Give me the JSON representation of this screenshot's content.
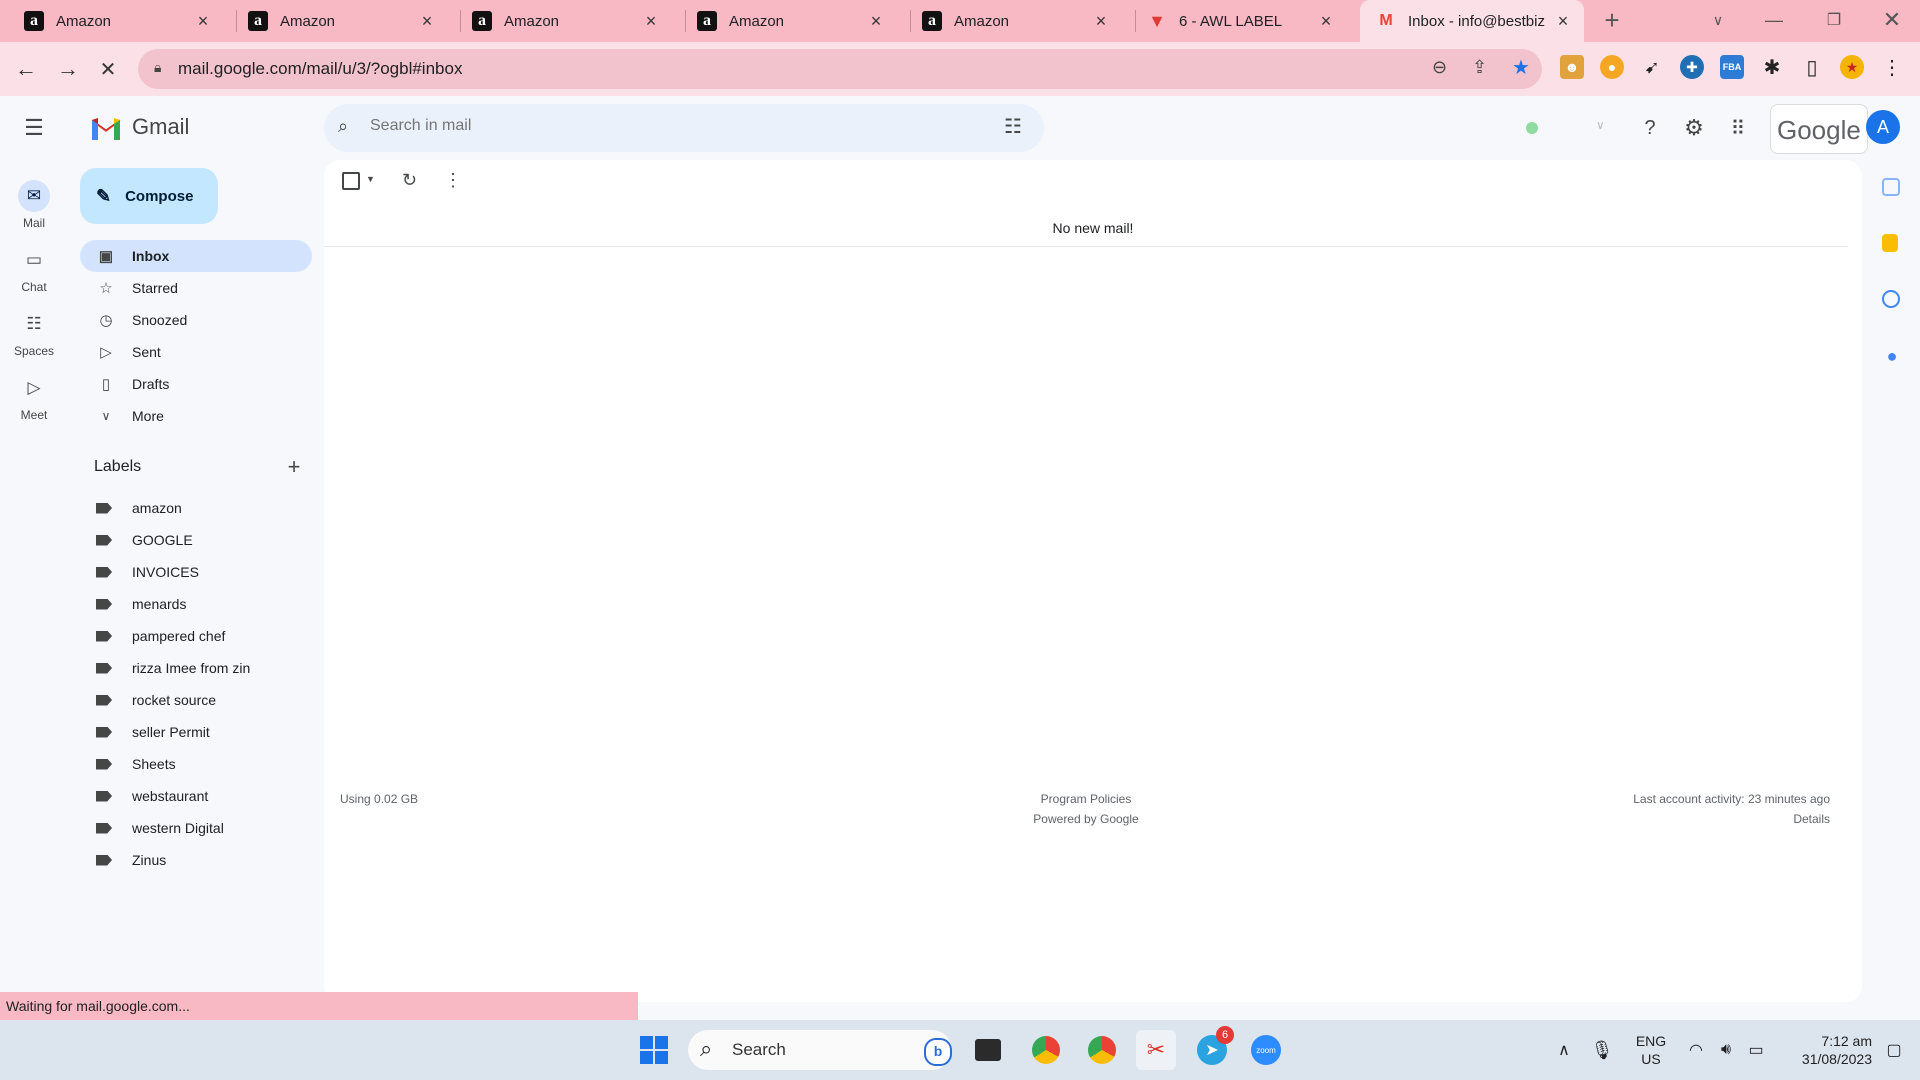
{
  "browser": {
    "tabs": [
      {
        "title": "Amazon",
        "favicon": "amazon-icon"
      },
      {
        "title": "Amazon",
        "favicon": "amazon-icon"
      },
      {
        "title": "Amazon",
        "favicon": "amazon-icon"
      },
      {
        "title": "Amazon",
        "favicon": "amazon-icon"
      },
      {
        "title": "Amazon",
        "favicon": "amazon-icon"
      },
      {
        "title": "6 - AWL LABEL",
        "favicon": "awl-icon"
      },
      {
        "title": "Inbox - info@bestbiz",
        "favicon": "gmail-icon",
        "active": true
      }
    ],
    "url": "mail.google.com/mail/u/3/?ogbl#inbox",
    "status_text": "Waiting for mail.google.com..."
  },
  "gmail": {
    "brand": "Gmail",
    "search_placeholder": "Search in mail",
    "google_label": "Google",
    "avatar_letter": "A",
    "rail": [
      {
        "label": "Mail",
        "icon": "mail-icon"
      },
      {
        "label": "Chat",
        "icon": "chat-icon"
      },
      {
        "label": "Spaces",
        "icon": "spaces-icon"
      },
      {
        "label": "Meet",
        "icon": "meet-icon"
      }
    ],
    "compose_label": "Compose",
    "nav": [
      {
        "label": "Inbox",
        "icon": "inbox-icon",
        "selected": true
      },
      {
        "label": "Starred",
        "icon": "star-icon"
      },
      {
        "label": "Snoozed",
        "icon": "clock-icon"
      },
      {
        "label": "Sent",
        "icon": "send-icon"
      },
      {
        "label": "Drafts",
        "icon": "draft-icon"
      },
      {
        "label": "More",
        "icon": "chevron-down-icon"
      }
    ],
    "labels_heading": "Labels",
    "labels": [
      "amazon",
      "GOOGLE",
      "INVOICES",
      "menards",
      "pampered chef",
      "rizza Imee from zin",
      "rocket source",
      "seller Permit",
      "Sheets",
      "webstaurant",
      "western Digital",
      "Zinus"
    ],
    "empty_message": "No new mail!",
    "footer": {
      "storage": "Using 0.02 GB",
      "policies": "Program Policies",
      "powered": "Powered by Google",
      "activity": "Last account activity: 23 minutes ago",
      "details": "Details"
    }
  },
  "taskbar": {
    "search_label": "Search",
    "telegram_badge": "6",
    "lang": "ENG",
    "region": "US",
    "time": "7:12 am",
    "date": "31/08/2023"
  },
  "colors": {
    "tab_strip": "#f8b8c4",
    "toolbar": "#fbe1e7",
    "compose": "#c2e7ff",
    "nav_selected": "#d3e3fd",
    "gmail_bg": "#f6f8fc"
  }
}
